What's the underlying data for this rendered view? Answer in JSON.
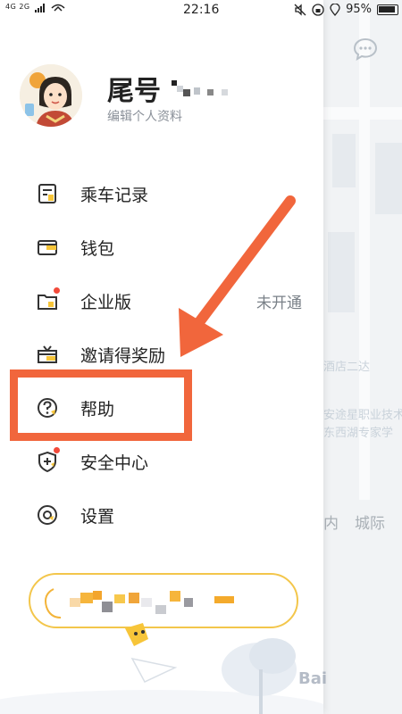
{
  "status_bar": {
    "network": "4G 2G",
    "time": "22:16",
    "battery": "95%"
  },
  "profile": {
    "name": "尾号",
    "edit_label": "编辑个人资料"
  },
  "menu": [
    {
      "label": "乘车记录",
      "icon": "ride-record-icon"
    },
    {
      "label": "钱包",
      "icon": "wallet-icon"
    },
    {
      "label": "企业版",
      "icon": "enterprise-icon",
      "status": "未开通",
      "badge": true
    },
    {
      "label": "邀请得奖励",
      "icon": "gift-icon"
    },
    {
      "label": "帮助",
      "icon": "help-icon"
    },
    {
      "label": "安全中心",
      "icon": "shield-icon",
      "badge": true
    },
    {
      "label": "设置",
      "icon": "settings-icon"
    }
  ],
  "background": {
    "tab_inner": "内",
    "tab_intercity": "城际",
    "watermark": "Bai"
  },
  "colors": {
    "accent": "#f1663c",
    "yellow": "#f7c539",
    "badge": "#f24a3a"
  }
}
